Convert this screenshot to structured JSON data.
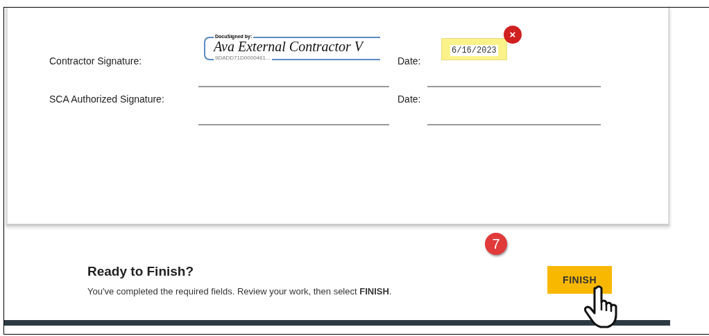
{
  "document": {
    "rows": [
      {
        "label": "Contractor Signature:",
        "signature": {
          "header": "DocuSigned by:",
          "name": "Ava External Contractor V",
          "id": "9DADD71D0000461..."
        },
        "date_label": "Date:",
        "date": {
          "value": "6/16/2023",
          "highlighted": true,
          "remove": "×"
        }
      },
      {
        "label": "SCA Authorized Signature:",
        "date_label": "Date:"
      }
    ]
  },
  "footer": {
    "step_badge": "7",
    "title": "Ready to Finish?",
    "message": "You've completed the required fields. Review your work, then select **FINISH**.",
    "button": "FINISH"
  }
}
